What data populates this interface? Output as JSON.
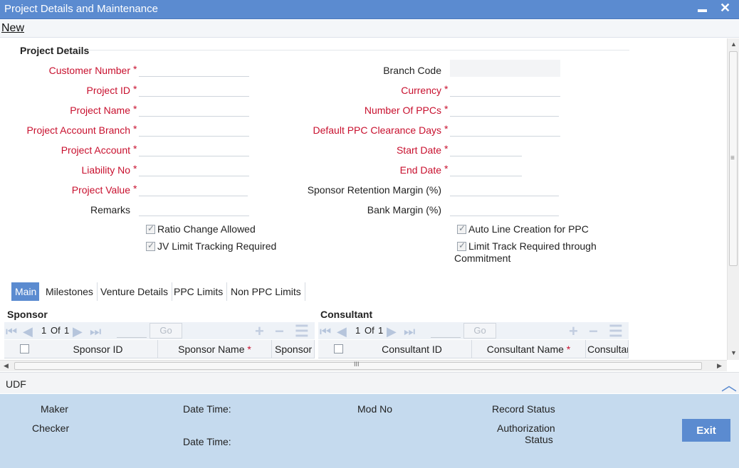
{
  "window": {
    "title": "Project Details and Maintenance",
    "minimize": "▬",
    "close": "✕"
  },
  "menu": {
    "new_label": "New"
  },
  "section": {
    "title": "Project Details"
  },
  "left_fields": [
    {
      "label": "Customer Number",
      "required": true,
      "value": ""
    },
    {
      "label": "Project ID",
      "required": true,
      "value": ""
    },
    {
      "label": "Project Name",
      "required": true,
      "value": ""
    },
    {
      "label": "Project Account Branch",
      "required": true,
      "value": ""
    },
    {
      "label": "Project Account",
      "required": true,
      "value": ""
    },
    {
      "label": "Liability No",
      "required": true,
      "value": ""
    },
    {
      "label": "Project Value",
      "required": true,
      "value": ""
    },
    {
      "label": "Remarks",
      "required": false,
      "value": ""
    }
  ],
  "right_fields": [
    {
      "label": "Branch Code",
      "required": false,
      "value": ""
    },
    {
      "label": "Currency",
      "required": true,
      "value": ""
    },
    {
      "label": "Number Of PPCs",
      "required": true,
      "value": ""
    },
    {
      "label": "Default PPC Clearance Days",
      "required": true,
      "value": ""
    },
    {
      "label": "Start Date",
      "required": true,
      "value": ""
    },
    {
      "label": "End Date",
      "required": true,
      "value": ""
    },
    {
      "label": "Sponsor Retention Margin (%)",
      "required": false,
      "value": ""
    },
    {
      "label": "Bank Margin (%)",
      "required": false,
      "value": ""
    }
  ],
  "required_mark": "*",
  "checkboxes": {
    "ratio_change": "Ratio Change Allowed",
    "jv_limit": "JV Limit Tracking Required",
    "auto_line": "Auto Line Creation for PPC",
    "limit_track_line1": "Limit Track Required through",
    "limit_track_line2": "Commitment"
  },
  "tabs": [
    "Main",
    "Milestones",
    "Venture Details",
    "PPC Limits",
    "Non PPC Limits"
  ],
  "sponsor": {
    "title": "Sponsor",
    "page_current": "1",
    "page_of": "Of",
    "page_total": "1",
    "go": "Go",
    "columns": [
      "Sponsor ID",
      "Sponsor Name",
      "Sponsor A"
    ]
  },
  "consultant": {
    "title": "Consultant",
    "page_current": "1",
    "page_of": "Of",
    "page_total": "1",
    "go": "Go",
    "columns": [
      "Consultant ID",
      "Consultant Name",
      "Consultan"
    ]
  },
  "hscroll_grip": "III",
  "vscroll_grip": "≡",
  "udf": {
    "label": "UDF"
  },
  "footer": {
    "maker": "Maker",
    "checker": "Checker",
    "date_time_1": "Date Time:",
    "date_time_2": "Date Time:",
    "mod_no": "Mod No",
    "record_status": "Record Status",
    "auth_status_line1": "Authorization",
    "auth_status_line2": "Status",
    "exit": "Exit"
  },
  "colors": {
    "accent": "#5b8bd0",
    "required": "#c8102e",
    "footer_bg": "#c5daee"
  }
}
